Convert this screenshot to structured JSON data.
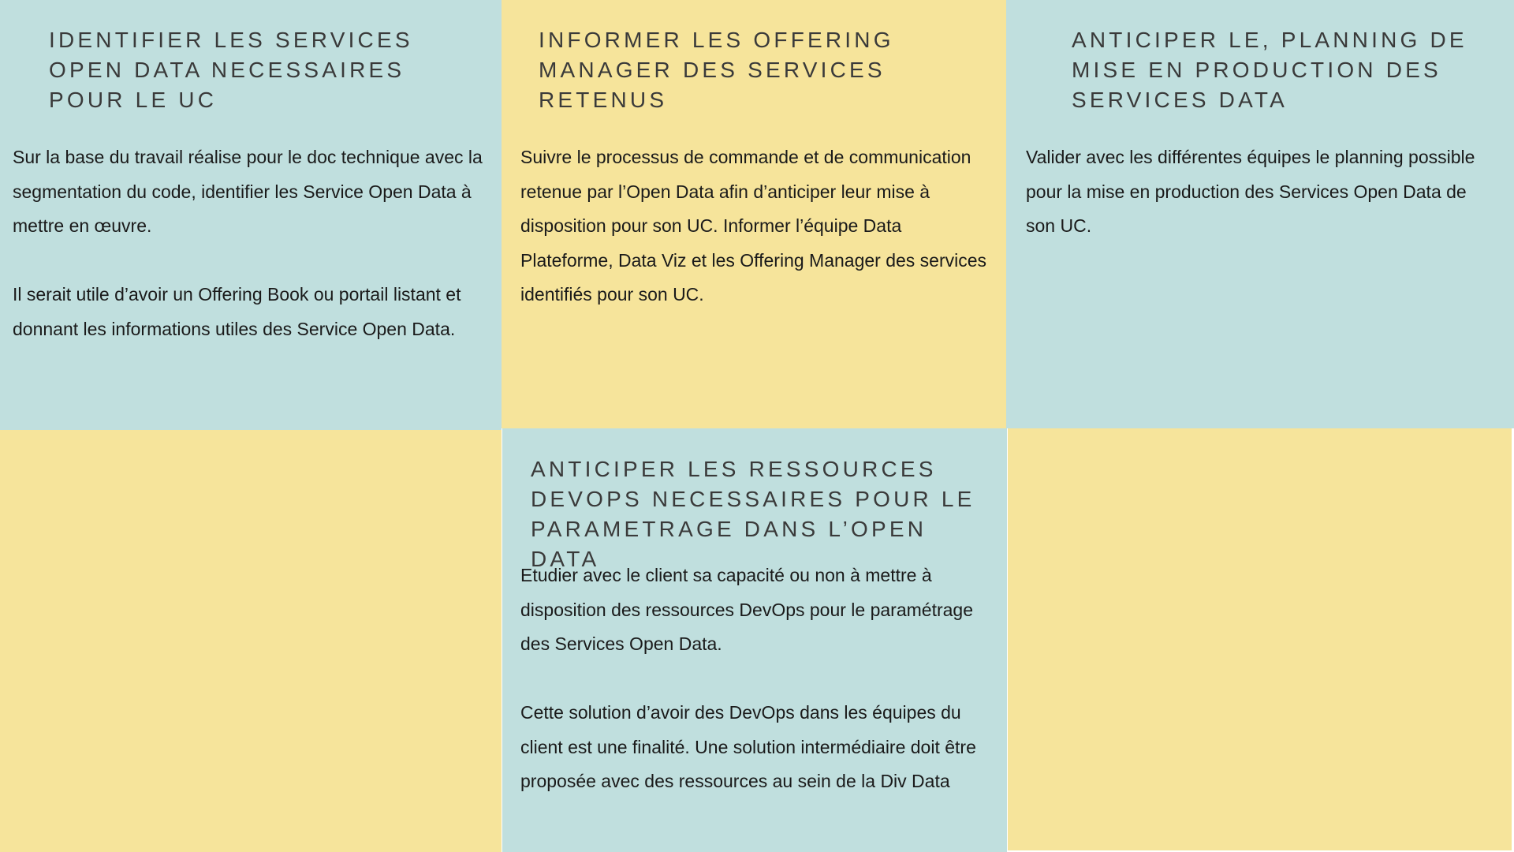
{
  "cards": [
    {
      "title": "IDENTIFIER LES SERVICES OPEN DATA NECESSAIRES POUR LE UC",
      "paragraphs": [
        "Sur la base du travail réalise pour le doc technique avec la segmentation du code, identifier les Service Open Data à mettre en œuvre.",
        "Il serait utile d’avoir un Offering Book ou portail listant et donnant les informations utiles des Service Open Data."
      ]
    },
    {
      "title": "INFORMER LES OFFERING MANAGER DES SERVICES RETENUS",
      "paragraphs": [
        "Suivre le processus de commande et de communication retenue par l’Open Data afin d’anticiper leur mise à disposition pour son UC. Informer l’équipe Data Plateforme, Data Viz et les Offering Manager des services identifiés pour son UC."
      ]
    },
    {
      "title": "ANTICIPER LE, PLANNING DE MISE EN PRODUCTION DES SERVICES DATA",
      "paragraphs": [
        "Valider avec les différentes équipes le planning possible pour la mise en production des Services Open Data de son UC."
      ]
    },
    {
      "title": "ANTICIPER LES RESSOURCES DEVOPS NECESSAIRES POUR LE PARAMETRAGE DANS L’OPEN DATA",
      "paragraphs": [
        "Etudier avec le client sa capacité ou non à mettre à disposition des ressources DevOps pour le paramétrage des Services Open Data.",
        "Cette solution d’avoir des DevOps dans les équipes du client est une finalité. Une solution intermédiaire doit être proposée avec des ressources au sein de la Div Data"
      ]
    }
  ],
  "colors": {
    "teal": "#c0dfde",
    "yellow": "#f6e49b",
    "heading_text": "#3a3a3a",
    "body_text": "#1a1a1a"
  }
}
